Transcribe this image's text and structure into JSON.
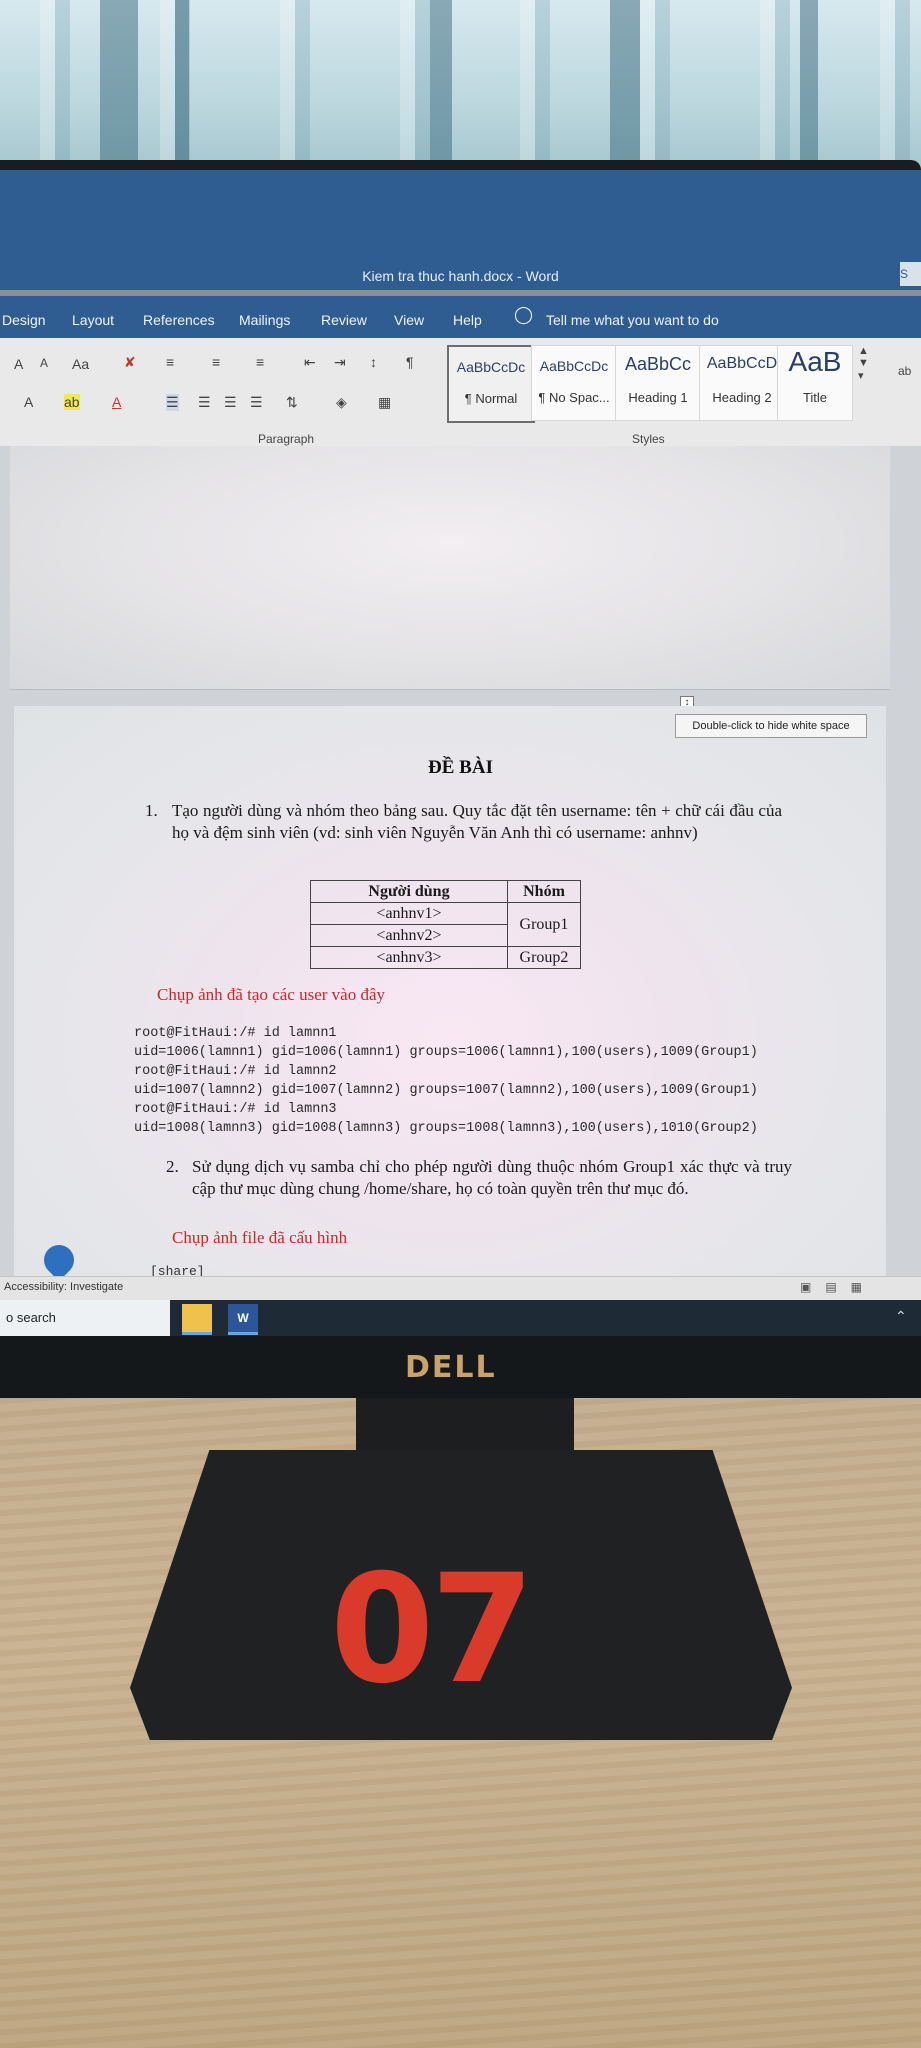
{
  "word": {
    "window_title": "Kiem tra thuc hanh.docx  -  Word",
    "title_button": "S",
    "menu": [
      "Design",
      "Layout",
      "References",
      "Mailings",
      "Review",
      "View",
      "Help"
    ],
    "tell_me": "Tell me what you want to do",
    "ribbon": {
      "font_buttons": [
        "A",
        "A",
        "Aa",
        "A",
        "A",
        "A"
      ],
      "styles": [
        {
          "preview": "AaBbCcDc",
          "name": "¶ Normal"
        },
        {
          "preview": "AaBbCcDc",
          "name": "¶ No Spac..."
        },
        {
          "preview": "AaBbCc",
          "name": "Heading 1"
        },
        {
          "preview": "AaBbCcD",
          "name": "Heading 2"
        },
        {
          "preview": "AaB",
          "name": "Title"
        }
      ],
      "groups": {
        "paragraph": "Paragraph",
        "styles": "Styles"
      },
      "right_text": "ab"
    },
    "hide_whitespace_tooltip": "Double-click to hide white space",
    "document": {
      "heading": "ĐỀ BÀI",
      "item1_number": "1.",
      "item1_text": "Tạo người dùng và nhóm theo bảng sau. Quy tắc đặt tên username: tên + chữ cái đầu của họ và đệm sinh viên (vd: sinh viên Nguyễn Văn Anh thì có username: anhnv)",
      "table": {
        "headers": [
          "Người dùng",
          "Nhóm"
        ],
        "users": [
          "<anhnv1>",
          "<anhnv2>",
          "<anhnv3>"
        ],
        "group_a": "Group1",
        "group_b": "Group2"
      },
      "caption1": "Chụp ảnh đã tạo các user vào đây",
      "terminal": [
        "root@FitHaui:/# id lamnn1",
        "uid=1006(lamnn1) gid=1006(lamnn1) groups=1006(lamnn1),100(users),1009(Group1)",
        "root@FitHaui:/# id lamnn2",
        "uid=1007(lamnn2) gid=1007(lamnn2) groups=1007(lamnn2),100(users),1009(Group1)",
        "root@FitHaui:/# id lamnn3",
        "uid=1008(lamnn3) gid=1008(lamnn3) groups=1008(lamnn3),100(users),1010(Group2)"
      ],
      "item2_number": "2.",
      "item2_text": "Sử dụng dịch vụ samba chỉ cho phép người dùng thuộc nhóm Group1 xác thực và truy cập thư mục dùng chung /home/share, họ có toàn quyền trên thư mục đó.",
      "caption2": "Chụp ảnh file đã cấu hình",
      "share_line": "[share]"
    },
    "status": {
      "accessibility": "Accessibility: Investigate"
    }
  },
  "taskbar": {
    "search": "o search",
    "word_icon": "W"
  },
  "monitor": {
    "brand": "DELL"
  },
  "desk_sticker": "07"
}
